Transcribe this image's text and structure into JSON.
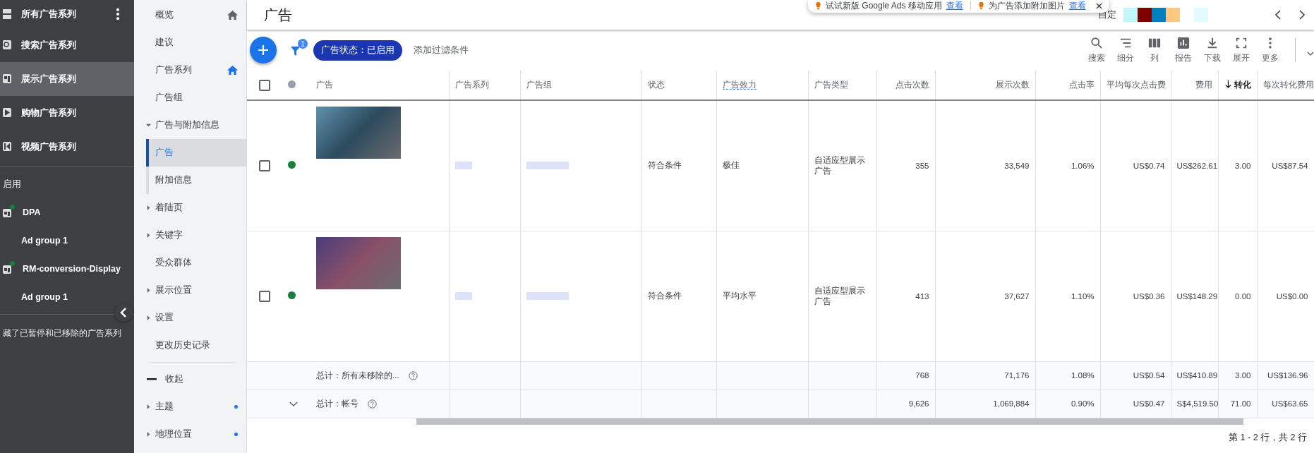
{
  "campaign_sidebar": {
    "header": {
      "label": "所有广告系列"
    },
    "types": [
      {
        "label": "搜索广告系列",
        "selected": false
      },
      {
        "label": "展示广告系列",
        "selected": true
      },
      {
        "label": "购物广告系列",
        "selected": false
      },
      {
        "label": "视频广告系列",
        "selected": false
      }
    ],
    "section_label": "启用",
    "campaigns": [
      {
        "label": "DPA",
        "color": "#188038",
        "children": [
          {
            "label": "Ad group 1"
          }
        ]
      },
      {
        "label": "RM-conversion-Display",
        "color": "#188038",
        "children": [
          {
            "label": "Ad group 1"
          }
        ]
      }
    ],
    "hidden_note": "藏了已暂停和已移除的广告系列"
  },
  "page_nav": {
    "items": [
      {
        "label": "概览",
        "selected": false
      },
      {
        "label": "建议",
        "selected": false
      },
      {
        "label": "广告系列",
        "selected": false
      },
      {
        "label": "广告组",
        "selected": false
      },
      {
        "label": "广告与附加信息",
        "expanded": true,
        "selected": false,
        "children": [
          {
            "label": "广告",
            "selected": true
          },
          {
            "label": "附加信息",
            "selected": false
          }
        ]
      },
      {
        "label": "着陆页",
        "expanded": false,
        "selected": false
      },
      {
        "label": "关键字",
        "expanded": false,
        "selected": false
      },
      {
        "label": "受众群体",
        "selected": false
      },
      {
        "label": "展示位置",
        "expanded": false,
        "selected": false
      },
      {
        "label": "设置",
        "expanded": false,
        "selected": false
      },
      {
        "label": "更改历史记录",
        "selected": false
      }
    ],
    "collapse_label": "收起",
    "more_items": [
      {
        "label": "主题",
        "expanded": false,
        "dot": true
      },
      {
        "label": "地理位置",
        "expanded": false,
        "dot": true
      }
    ]
  },
  "page_title": "广告",
  "notices": [
    {
      "text": "试试新版 Google Ads 移动应用",
      "link": "查看"
    },
    {
      "text": "为广告添加附加图片",
      "link": "查看"
    }
  ],
  "header_right": {
    "label": "自定"
  },
  "toolbar": {
    "filter_count": "1",
    "filter_chip": "广告状态：已启用",
    "add_filter": "添加过滤条件",
    "actions": [
      {
        "label": "搜索"
      },
      {
        "label": "细分"
      },
      {
        "label": "列"
      },
      {
        "label": "报告"
      },
      {
        "label": "下载"
      },
      {
        "label": "展开"
      },
      {
        "label": "更多"
      }
    ]
  },
  "table": {
    "select_all_checked": false,
    "columns": [
      {
        "label": "广告"
      },
      {
        "label": "广告系列"
      },
      {
        "label": "广告组"
      },
      {
        "label": "状态"
      },
      {
        "label": "广告效力"
      },
      {
        "label": "广告类型"
      },
      {
        "label": "点击次数"
      },
      {
        "label": "展示次数"
      },
      {
        "label": "点击率"
      },
      {
        "label": "平均每次点击费"
      },
      {
        "label": "费用"
      },
      {
        "label": "转化",
        "sorted": true
      },
      {
        "label": "每次转化费用"
      }
    ],
    "rows": [
      {
        "checked": false,
        "color": "#188038",
        "cells": [
          "",
          "",
          "",
          "符合条件",
          "极佳",
          "自适应型展示广告",
          "355",
          "33,549",
          "1.06%",
          "US$0.74",
          "US$262.61",
          "3.00",
          "US$87.54"
        ]
      },
      {
        "checked": false,
        "color": "#188038",
        "cells": [
          "",
          "",
          "",
          "符合条件",
          "平均水平",
          "自适应型展示广告",
          "413",
          "37,627",
          "1.10%",
          "US$0.36",
          "US$148.29",
          "0.00",
          "US$0.00"
        ]
      }
    ],
    "totals": [
      {
        "expander": false,
        "cells": [
          "总计：所有未移除的...",
          "",
          "",
          "",
          "",
          "",
          "768",
          "71,176",
          "1.08%",
          "US$0.54",
          "US$410.89",
          "3.00",
          "US$136.96"
        ]
      },
      {
        "expander": true,
        "cells": [
          "总计：帐号",
          "",
          "",
          "",
          "",
          "",
          "9,626",
          "1,069,884",
          "0.90%",
          "US$0.47",
          "S$4,519.50",
          "71.00",
          "US$63.65"
        ]
      }
    ]
  },
  "pagination": "第 1 - 2 行，共 2 行"
}
